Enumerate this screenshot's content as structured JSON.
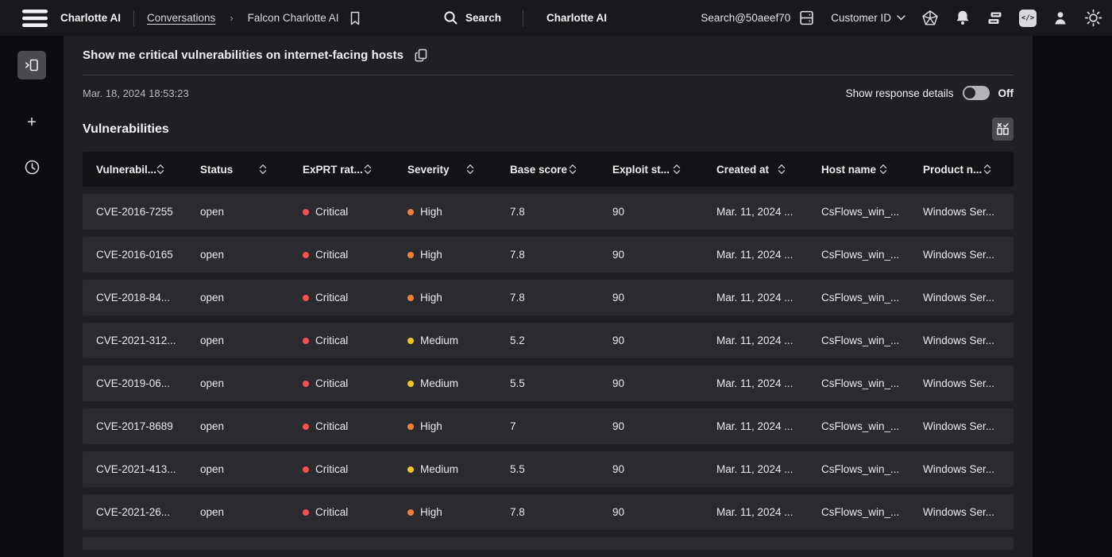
{
  "topbar": {
    "app_title": "Charlotte AI",
    "breadcrumb_parent": "Conversations",
    "breadcrumb_separator": "›",
    "breadcrumb_current": "Falcon Charlotte AI",
    "search_label": "Search",
    "center_title": "Charlotte AI",
    "account": "Search@50aeef70",
    "customer_label": "Customer ID",
    "code_glyph": "</>"
  },
  "icons": {
    "hamburger": "menu-icon",
    "bookmark": "bookmark-icon",
    "search": "search-icon",
    "server": "server-icon",
    "pentagon": "pentagon-badge-icon",
    "bell": "bell-icon",
    "chat": "chat-icon",
    "code": "code-icon",
    "user": "user-icon",
    "sun": "sun-theme-icon",
    "panel": "panel-toggle-icon",
    "plus": "new-conversation-icon",
    "clock": "history-clock-icon",
    "copy": "copy-icon",
    "columns": "column-settings-icon"
  },
  "sidebar": {
    "plus_glyph": "+"
  },
  "message": {
    "query": "Show me critical vulnerabilities on internet-facing hosts",
    "timestamp": "Mar. 18, 2024 18:53:23",
    "response_details_label": "Show response details",
    "toggle_state_label": "Off"
  },
  "section": {
    "title": "Vulnerabilities"
  },
  "table": {
    "columns": [
      "Vulnerabil...",
      "Status",
      "ExPRT rat...",
      "Severity",
      "Base score",
      "Exploit st...",
      "Created at",
      "Host name",
      "Product n..."
    ],
    "rows": [
      {
        "cve": "CVE-2016-7255",
        "status": "open",
        "exprt": "Critical",
        "severity": "High",
        "base_score": "7.8",
        "exploit_status": "90",
        "created_at": "Mar. 11, 2024 ...",
        "host": "CsFlows_win_...",
        "product": "Windows Ser..."
      },
      {
        "cve": "CVE-2016-0165",
        "status": "open",
        "exprt": "Critical",
        "severity": "High",
        "base_score": "7.8",
        "exploit_status": "90",
        "created_at": "Mar. 11, 2024 ...",
        "host": "CsFlows_win_...",
        "product": "Windows Ser..."
      },
      {
        "cve": "CVE-2018-84...",
        "status": "open",
        "exprt": "Critical",
        "severity": "High",
        "base_score": "7.8",
        "exploit_status": "90",
        "created_at": "Mar. 11, 2024 ...",
        "host": "CsFlows_win_...",
        "product": "Windows Ser..."
      },
      {
        "cve": "CVE-2021-312...",
        "status": "open",
        "exprt": "Critical",
        "severity": "Medium",
        "base_score": "5.2",
        "exploit_status": "90",
        "created_at": "Mar. 11, 2024 ...",
        "host": "CsFlows_win_...",
        "product": "Windows Ser..."
      },
      {
        "cve": "CVE-2019-06...",
        "status": "open",
        "exprt": "Critical",
        "severity": "Medium",
        "base_score": "5.5",
        "exploit_status": "90",
        "created_at": "Mar. 11, 2024 ...",
        "host": "CsFlows_win_...",
        "product": "Windows Ser..."
      },
      {
        "cve": "CVE-2017-8689",
        "status": "open",
        "exprt": "Critical",
        "severity": "High",
        "base_score": "7",
        "exploit_status": "90",
        "created_at": "Mar. 11, 2024 ...",
        "host": "CsFlows_win_...",
        "product": "Windows Ser..."
      },
      {
        "cve": "CVE-2021-413...",
        "status": "open",
        "exprt": "Critical",
        "severity": "Medium",
        "base_score": "5.5",
        "exploit_status": "90",
        "created_at": "Mar. 11, 2024 ...",
        "host": "CsFlows_win_...",
        "product": "Windows Ser..."
      },
      {
        "cve": "CVE-2021-26...",
        "status": "open",
        "exprt": "Critical",
        "severity": "High",
        "base_score": "7.8",
        "exploit_status": "90",
        "created_at": "Mar. 11, 2024 ...",
        "host": "CsFlows_win_...",
        "product": "Windows Ser..."
      }
    ]
  },
  "colors": {
    "critical": "#fa4d56",
    "high": "#f1803c",
    "medium": "#f0c325",
    "accent_row": "#2b2b2f"
  }
}
